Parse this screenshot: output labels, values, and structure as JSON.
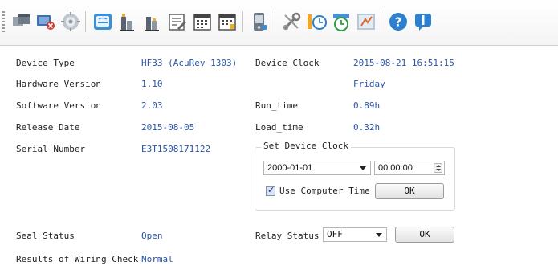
{
  "toolbar": {
    "icons": [
      "windows-icon",
      "network-disconnect-icon",
      "settings-disc-icon",
      "meter-icon",
      "bar-chart-icon",
      "bar-chart-alt-icon",
      "report-edit-icon",
      "calendar-icon",
      "calendar-alt-icon",
      "phone-device-icon",
      "tools-icon",
      "clock-settings-icon",
      "timer-icon",
      "energy-icon",
      "help-icon",
      "info-icon"
    ]
  },
  "device": {
    "type_label": "Device Type",
    "type_value": "HF33 (AcuRev 1303)",
    "hw_label": "Hardware Version",
    "hw_value": "1.10",
    "sw_label": "Software Version",
    "sw_value": "2.03",
    "release_label": "Release Date",
    "release_value": "2015-08-05",
    "serial_label": "Serial Number",
    "serial_value": "E3T1508171122",
    "clock_label": "Device Clock",
    "clock_value": "2015-08-21 16:51:15",
    "weekday_value": "Friday",
    "run_label": "Run_time",
    "run_value": "0.89h",
    "load_label": "Load_time",
    "load_value": "0.32h"
  },
  "set_clock": {
    "title": "Set Device Clock",
    "date_value": "2000-01-01",
    "time_value": "00:00:00",
    "use_computer_time_label": "Use Computer Time",
    "ok_label": "OK"
  },
  "status": {
    "seal_label": "Seal Status",
    "seal_value": "Open",
    "relay_label": "Relay Status",
    "relay_value": "OFF",
    "relay_ok_label": "OK",
    "wiring_label": "Results of Wiring Check",
    "wiring_value": "Normal"
  }
}
